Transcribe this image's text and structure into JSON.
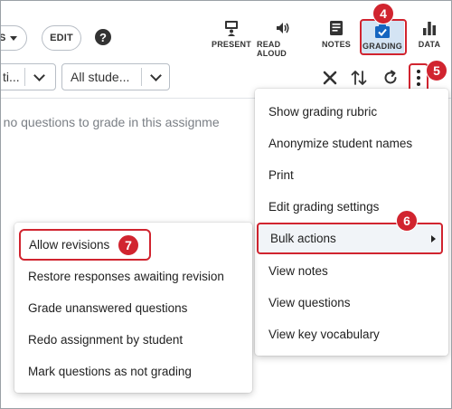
{
  "toolbar": {
    "first_button_label": "S",
    "edit_label": "EDIT",
    "help_glyph": "?",
    "tools": {
      "present": "PRESENT",
      "read_aloud": "READ ALOUD",
      "notes": "NOTES",
      "grading": "GRADING",
      "data": "DATA"
    }
  },
  "filters": {
    "first_select_value": "ti...",
    "student_select_value": "All stude..."
  },
  "notice": "e no questions to grade in this assignme",
  "callouts": {
    "grading": "4",
    "more": "5",
    "bulk": "6",
    "allow": "7"
  },
  "main_menu": {
    "items": [
      "Show grading rubric",
      "Anonymize student names",
      "Print",
      "Edit grading settings",
      "Bulk actions",
      "View notes",
      "View questions",
      "View key vocabulary"
    ]
  },
  "submenu": {
    "items": [
      "Allow revisions",
      "Restore responses awaiting revision",
      "Grade unanswered questions",
      "Redo assignment by student",
      "Mark questions as not grading"
    ]
  },
  "colors": {
    "highlight": "#d1242f",
    "active_tool_bg": "#d4e4f4",
    "icon_blue": "#1565c0"
  },
  "icons": [
    "help-icon",
    "present-icon",
    "speaker-icon",
    "notes-icon",
    "grading-check-icon",
    "bar-chart-icon",
    "close-icon",
    "sort-icon",
    "refresh-icon",
    "more-vertical-icon",
    "chevron-down-icon",
    "submenu-arrow-icon"
  ]
}
